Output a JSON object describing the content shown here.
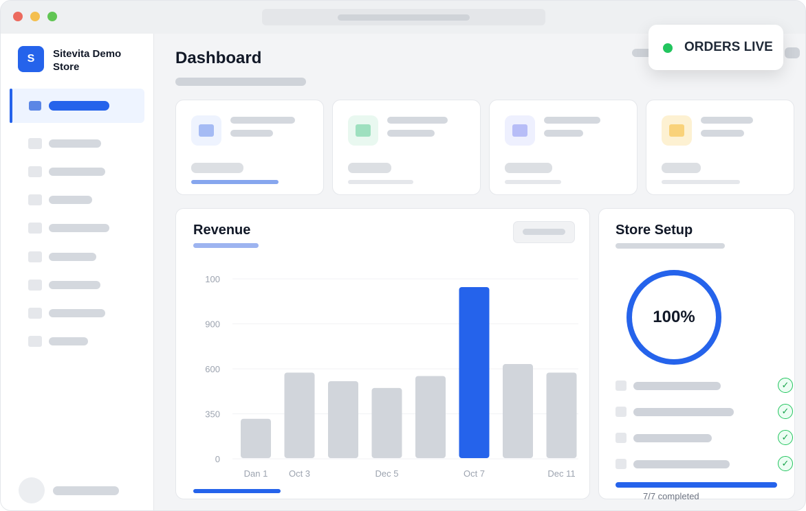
{
  "app": {
    "store_name": "Sitevita Demo Store",
    "logo_letter": "S"
  },
  "header": {
    "title": "Dashboard"
  },
  "status": {
    "label": "ORDERS LIVE",
    "color": "#22c55e"
  },
  "stat_cards": [
    {
      "icon": "stat-icon-blue",
      "icon_bg": "#eef3fe",
      "icon_color": "#a5bbf4",
      "bar_color": "#86a6ee"
    },
    {
      "icon": "stat-icon-green",
      "icon_bg": "#e9f8f0",
      "icon_color": "#9ee0bf",
      "bar_color": "#e5e7eb"
    },
    {
      "icon": "stat-icon-indigo",
      "icon_bg": "#eef0fe",
      "icon_color": "#b7bdf7",
      "bar_color": "#e5e7eb"
    },
    {
      "icon": "stat-icon-amber",
      "icon_bg": "#fdf1d2",
      "icon_color": "#f9d27a",
      "bar_color": "#e5e7eb"
    }
  ],
  "revenue": {
    "title": "Revenue"
  },
  "chart_data": {
    "type": "bar",
    "title": "Revenue",
    "yticks": [
      "100",
      "900",
      "600",
      "350",
      "0"
    ],
    "xticks": [
      "Dan 1",
      "Oct 3",
      "Dec 5",
      "Oct 7",
      "Dec 11"
    ],
    "values": [
      0.23,
      0.5,
      0.45,
      0.41,
      0.48,
      1.0,
      0.55,
      0.5
    ],
    "highlight_index": 5,
    "bar_color": "#d1d5db",
    "highlight_color": "#2563eb"
  },
  "setup": {
    "title": "Store Setup",
    "percent_label": "100%",
    "percent": 100,
    "checkmark": "✓",
    "completed_label": "7/7 completed"
  },
  "colors": {
    "accent": "#2563eb",
    "success": "#22c55e"
  }
}
